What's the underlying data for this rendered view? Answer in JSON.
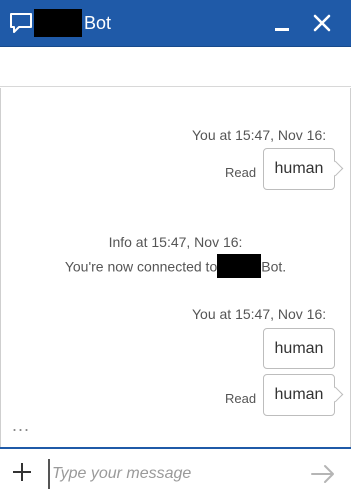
{
  "header": {
    "title": "Bot",
    "icons": {
      "chat": "chat-bubble-icon",
      "minimize": "minimize-icon",
      "close": "close-icon"
    }
  },
  "messages": [
    {
      "type": "user",
      "meta": "You at 15:47, Nov 16:",
      "items": [
        {
          "text": "human",
          "status": "Read"
        }
      ]
    },
    {
      "type": "info",
      "meta": "Info at 15:47, Nov 16:",
      "text_before": "You're now connected to",
      "text_after": "Bot."
    },
    {
      "type": "user",
      "meta": "You at 15:47, Nov 16:",
      "items": [
        {
          "text": "human",
          "status": ""
        },
        {
          "text": "human",
          "status": "Read"
        }
      ]
    }
  ],
  "typing_indicator": "...",
  "composer": {
    "placeholder": "Type your message",
    "value": ""
  },
  "colors": {
    "header": "#1f5aa8",
    "composer_border": "#1f5aa8"
  }
}
